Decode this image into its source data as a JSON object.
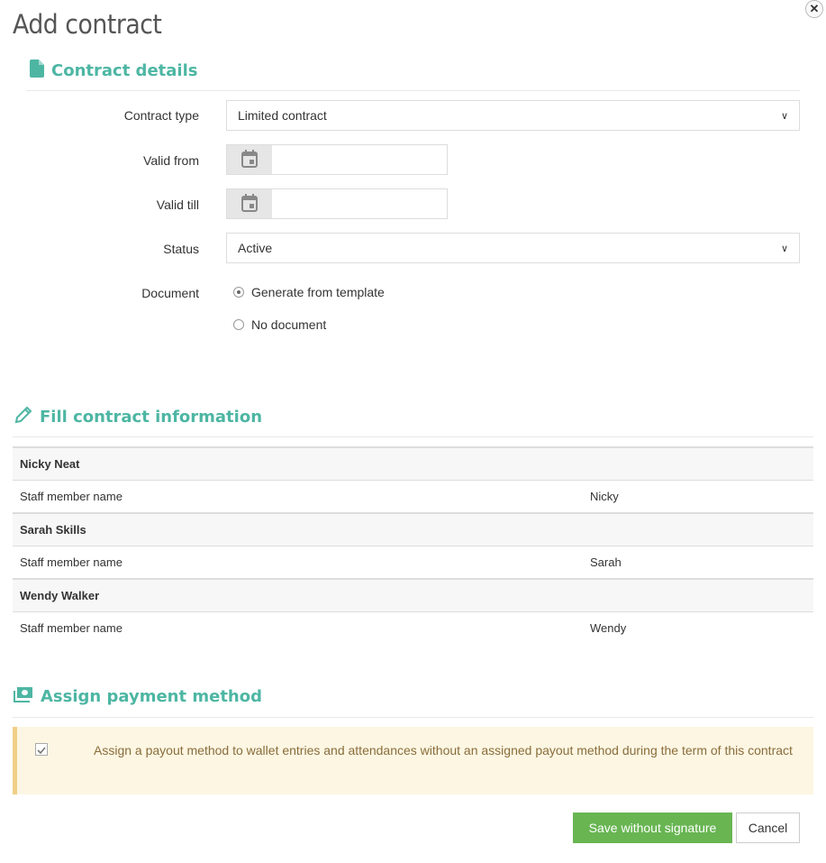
{
  "dialog": {
    "title": "Add contract",
    "close_icon": "close-icon"
  },
  "contract_details": {
    "heading": "Contract details",
    "icon": "file-icon",
    "fields": {
      "contract_type": {
        "label": "Contract type",
        "value": "Limited contract"
      },
      "valid_from": {
        "label": "Valid from",
        "value": ""
      },
      "valid_till": {
        "label": "Valid till",
        "value": ""
      },
      "status": {
        "label": "Status",
        "value": "Active"
      },
      "document": {
        "label": "Document",
        "options": [
          {
            "label": "Generate from template",
            "selected": true
          },
          {
            "label": "No document",
            "selected": false
          }
        ]
      }
    }
  },
  "fill_info": {
    "heading": "Fill contract information",
    "icon": "pencil-icon",
    "groups": [
      {
        "name": "Nicky Neat",
        "rows": [
          {
            "field": "Staff member name",
            "value": "Nicky"
          }
        ]
      },
      {
        "name": "Sarah Skills",
        "rows": [
          {
            "field": "Staff member name",
            "value": "Sarah"
          }
        ]
      },
      {
        "name": "Wendy Walker",
        "rows": [
          {
            "field": "Staff member name",
            "value": "Wendy"
          }
        ]
      }
    ]
  },
  "payment": {
    "heading": "Assign payment method",
    "icon": "money-icon",
    "checkbox_checked": true,
    "checkbox_text": "Assign a payout method to wallet entries and attendances without an assigned payout method during the term of this contract"
  },
  "footer": {
    "save_label": "Save without signature",
    "cancel_label": "Cancel"
  },
  "colors": {
    "accent": "#4db6a3",
    "save_button": "#68b552",
    "alert_bg": "#fcf6e3",
    "alert_border": "#f0cf87",
    "alert_text": "#8a6d3b"
  }
}
